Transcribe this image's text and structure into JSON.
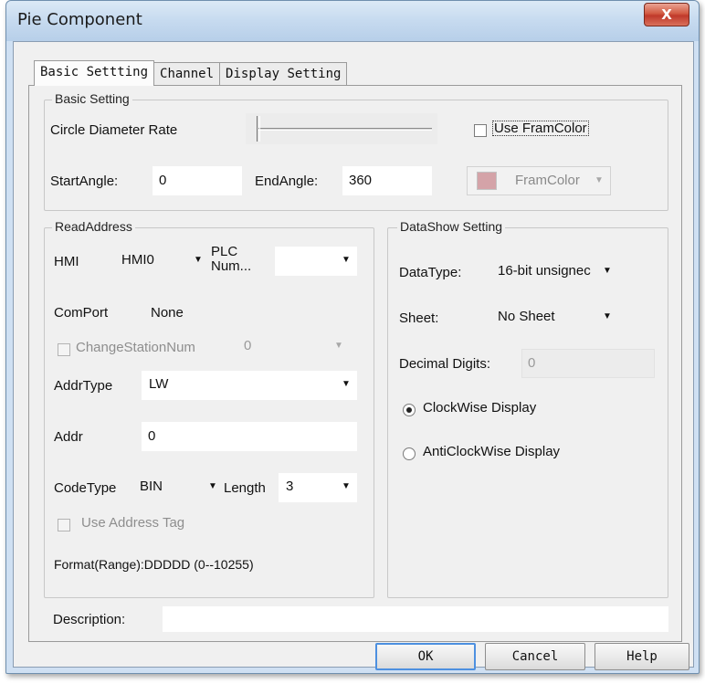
{
  "window": {
    "title": "Pie Component",
    "close_glyph": "X"
  },
  "tabs": [
    {
      "label": "Basic Settting",
      "active": true
    },
    {
      "label": "Channel",
      "active": false
    },
    {
      "label": "Display Setting",
      "active": false
    }
  ],
  "basic_setting": {
    "group_title": "Basic Setting",
    "circle_diameter_label": "Circle Diameter Rate",
    "circle_diameter_value": 0.0,
    "use_fram_color_label": "Use FramColor",
    "use_fram_color_checked": false,
    "start_angle_label": "StartAngle:",
    "start_angle_value": "0",
    "end_angle_label": "EndAngle:",
    "end_angle_value": "360",
    "fram_color_label": "FramColor",
    "fram_color_swatch": "#d4a3a8"
  },
  "read_address": {
    "group_title": "ReadAddress",
    "hmi_label": "HMI",
    "hmi_value": "HMI0",
    "plc_num_label_line1": "PLC",
    "plc_num_label_line2": "Num...",
    "plc_num_value": "",
    "comport_label": "ComPort",
    "comport_value": "None",
    "change_station_label": "ChangeStationNum",
    "change_station_value": "0",
    "addr_type_label": "AddrType",
    "addr_type_value": "LW",
    "addr_label": "Addr",
    "addr_value": "0",
    "code_type_label": "CodeType",
    "code_type_value": "BIN",
    "length_label": "Length",
    "length_value": "3",
    "use_address_tag_label": "Use Address Tag",
    "format_text": "Format(Range):DDDDD (0--10255)"
  },
  "data_show": {
    "group_title": "DataShow Setting",
    "data_type_label": "DataType:",
    "data_type_value": "16-bit unsignec",
    "sheet_label": "Sheet:",
    "sheet_value": "No Sheet",
    "decimal_digits_label": "Decimal Digits:",
    "decimal_digits_value": "0",
    "clockwise_label": "ClockWise Display",
    "anticlockwise_label": "AntiClockWise Display",
    "selected_direction": "clockwise"
  },
  "description": {
    "label": "Description:",
    "value": ""
  },
  "buttons": {
    "ok": "OK",
    "cancel": "Cancel",
    "help": "Help"
  },
  "icons": {
    "dropdown": "dropdown-arrow-icon",
    "close": "close-icon"
  }
}
